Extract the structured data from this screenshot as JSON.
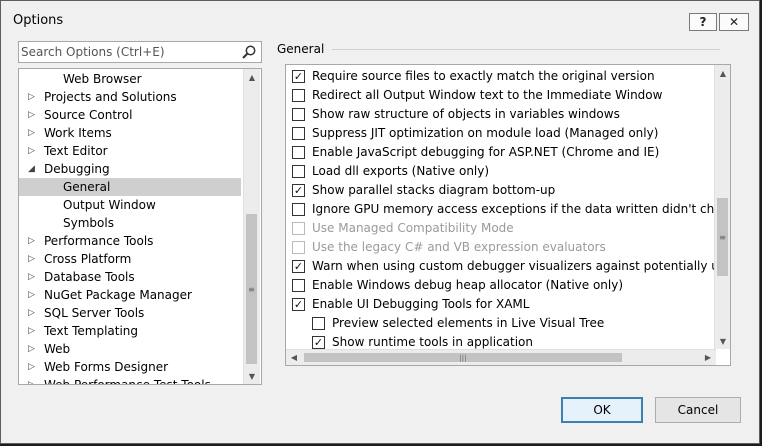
{
  "window": {
    "title": "Options",
    "help_label": "?",
    "close_label": "✕"
  },
  "search": {
    "placeholder": "Search Options (Ctrl+E)"
  },
  "tree": {
    "items": [
      {
        "label": "Web Browser",
        "arrow": ""
      },
      {
        "label": "Projects and Solutions",
        "arrow": "▷"
      },
      {
        "label": "Source Control",
        "arrow": "▷"
      },
      {
        "label": "Work Items",
        "arrow": "▷"
      },
      {
        "label": "Text Editor",
        "arrow": "▷"
      },
      {
        "label": "Debugging",
        "arrow": "◢"
      },
      {
        "label": "General",
        "arrow": "",
        "selected": true
      },
      {
        "label": "Output Window",
        "arrow": ""
      },
      {
        "label": "Symbols",
        "arrow": ""
      },
      {
        "label": "Performance Tools",
        "arrow": "▷"
      },
      {
        "label": "Cross Platform",
        "arrow": "▷"
      },
      {
        "label": "Database Tools",
        "arrow": "▷"
      },
      {
        "label": "NuGet Package Manager",
        "arrow": "▷"
      },
      {
        "label": "SQL Server Tools",
        "arrow": "▷"
      },
      {
        "label": "Text Templating",
        "arrow": "▷"
      },
      {
        "label": "Web",
        "arrow": "▷"
      },
      {
        "label": "Web Forms Designer",
        "arrow": "▷"
      },
      {
        "label": "Web Performance Test Tools",
        "arrow": "▷"
      }
    ]
  },
  "section": {
    "title": "General"
  },
  "options": [
    {
      "label": "Require source files to exactly match the original version",
      "checked": true
    },
    {
      "label": "Redirect all Output Window text to the Immediate Window",
      "checked": false
    },
    {
      "label": "Show raw structure of objects in variables windows",
      "checked": false
    },
    {
      "label": "Suppress JIT optimization on module load (Managed only)",
      "checked": false
    },
    {
      "label": "Enable JavaScript debugging for ASP.NET (Chrome and IE)",
      "checked": false,
      "highlighted": true
    },
    {
      "label": "Load dll exports (Native only)",
      "checked": false
    },
    {
      "label": "Show parallel stacks diagram bottom-up",
      "checked": true
    },
    {
      "label": "Ignore GPU memory access exceptions if the data written didn't change the value",
      "checked": false
    },
    {
      "label": "Use Managed Compatibility Mode",
      "checked": false,
      "disabled": true
    },
    {
      "label": "Use the legacy C# and VB expression evaluators",
      "checked": false,
      "disabled": true
    },
    {
      "label": "Warn when using custom debugger visualizers against potentially unsafe processes",
      "checked": true
    },
    {
      "label": "Enable Windows debug heap allocator (Native only)",
      "checked": false
    },
    {
      "label": "Enable UI Debugging Tools for XAML",
      "checked": true
    },
    {
      "label": "Preview selected elements in Live Visual Tree",
      "checked": false,
      "indent": true
    },
    {
      "label": "Show runtime tools in application",
      "checked": true,
      "indent": true
    }
  ],
  "buttons": {
    "ok_label": "OK",
    "cancel_label": "Cancel"
  },
  "colors": {
    "highlight": "#ffff1a",
    "selection": "#cfcfcf",
    "ok_border": "#3c7fb1"
  },
  "icons": {
    "search": "magnifier-icon",
    "check": "✓"
  }
}
